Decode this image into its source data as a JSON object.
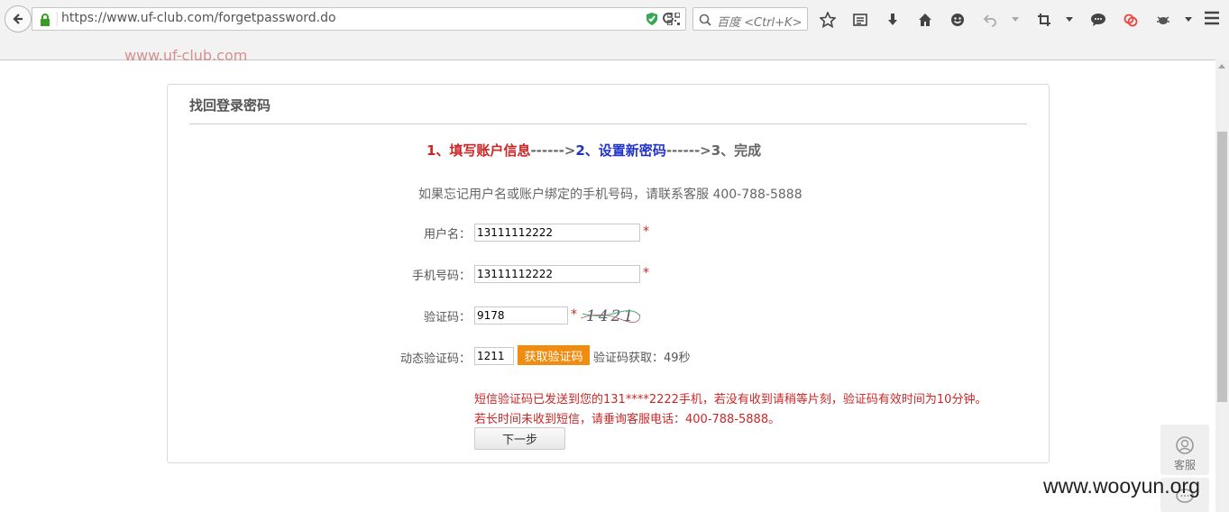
{
  "browser": {
    "url": "https://www.uf-club.com/forgetpassword.do",
    "search_placeholder": "百度 <Ctrl+K>"
  },
  "page": {
    "cut_text": "www.uf-club.com",
    "panel_title": "找回登录密码",
    "steps": {
      "step1": "1、填写账户信息",
      "arrow1": "------>",
      "step2": "2、设置新密码",
      "arrow2": "------>",
      "step3": "3、完成"
    },
    "hint": "如果忘记用户名或账户绑定的手机号码，请联系客服 400-788-5888",
    "form": {
      "username_label": "用户名：",
      "username_value": "13111112222",
      "phone_label": "手机号码：",
      "phone_value": "13111112222",
      "captcha_label": "验证码：",
      "captcha_value": "9178",
      "captcha_image_text": "1421",
      "sms_label": "动态验证码：",
      "sms_value": "1211",
      "required_mark": "*",
      "get_code_button": "获取验证码",
      "countdown": "验证码获取：49秒"
    },
    "message_line1": "短信验证码已发送到您的131****2222手机，若没有收到请稍等片刻，验证码有效时间为10分钟。",
    "message_line2": "若长时间未收到短信，请垂询客服电话：400-788-5888。",
    "next_button": "下一步",
    "customer_service_label": "客服",
    "watermark": "www.wooyun.org"
  }
}
